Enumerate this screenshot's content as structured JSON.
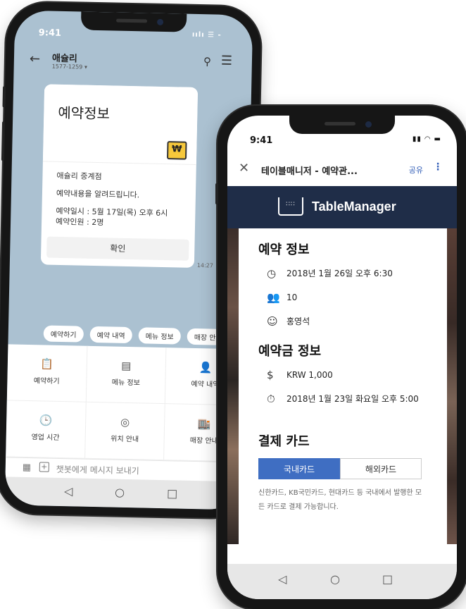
{
  "chat_app": {
    "status_time": "9:41",
    "status_icons": "ıılı ☰ -",
    "contact_name": "애슐리",
    "contact_phone": "1577-1259 ▾",
    "card_title": "예약정보",
    "wallet_symbol": "₩",
    "lines": [
      "애슐리 중계점",
      "예약내용을 알려드립니다."
    ],
    "detail_date": "예약일시 : 5월 17일(목) 오후 6시",
    "detail_people": "예약인원 : 2명",
    "confirm_button": "확인",
    "timestamp": "14:27",
    "quick_replies": [
      "예약하기",
      "예약 내역",
      "메뉴 정보",
      "매장 안"
    ],
    "grid_items": [
      {
        "label": "예약하기",
        "icon": "📋"
      },
      {
        "label": "메뉴 정보",
        "icon": "▤"
      },
      {
        "label": "예약 내역",
        "icon": "👤"
      },
      {
        "label": "영업 시간",
        "icon": "🕒"
      },
      {
        "label": "위치 안내",
        "icon": "◎"
      },
      {
        "label": "매장 안내",
        "icon": "🏬"
      }
    ],
    "input_placeholder": "챗봇에게 메시지 보내기",
    "nav": {
      "back": "◁",
      "home": "○",
      "recent": "□"
    }
  },
  "table_app": {
    "status_time": "9:41",
    "status_icons": "▮▮ ◠ ▬",
    "header_title": "테이블매니저 - 예약관...",
    "share_label": "공유",
    "more_label": "⋮",
    "brand_logo_text": "∷∷",
    "brand_name": "TableManager",
    "sections": {
      "reservation_title": "예약 정보",
      "reservation_datetime": "2018년 1월 26일 오후 6:30",
      "reservation_people": "10",
      "reservation_name": "홍영석",
      "deposit_title": "예약금 정보",
      "deposit_amount": "KRW 1,000",
      "deposit_deadline": "2018년 1월 23일 화요일 오후 5:00",
      "card_title": "결제 카드"
    },
    "tabs": {
      "domestic": "국내카드",
      "overseas": "해외카드"
    },
    "note": "신한카드, KB국민카드, 현대카드 등 국내에서 발행한 모든 카드로 결제 가능합니다.",
    "nav": {
      "back": "◁",
      "home": "○",
      "recent": "□"
    }
  }
}
